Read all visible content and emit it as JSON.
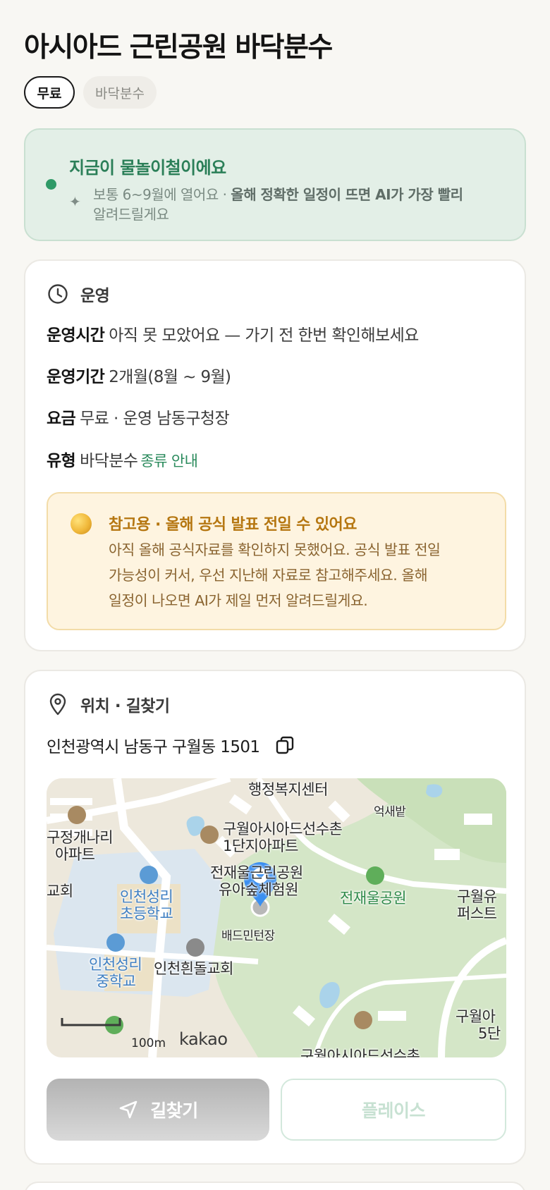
{
  "page": {
    "title": "아시아드 근린공원 바닥분수",
    "chips": {
      "price": "무료",
      "type": "바닥분수"
    }
  },
  "season": {
    "headline": "지금이 물놀이철이에요",
    "desc_plain": "보통 6~9월에 열어요 · ",
    "desc_bold": "올해 정확한 일정이 뜨면 AI가 가장 빨리",
    "desc_tail": "알려드릴게요",
    "icon": "sparkle-icon",
    "dot_color": "#2f9a67"
  },
  "operation": {
    "section_label": "운영",
    "icon": "clock-icon",
    "rows": {
      "hours": {
        "key": "운영시간",
        "value": "아직 못 모았어요 — 가기 전 한번 확인해보세요"
      },
      "period": {
        "key": "운영기간",
        "value": "2개월(8월 ~ 9월)"
      },
      "fee": {
        "key": "요금",
        "value": "무료 · 운영 남동구청장"
      },
      "type": {
        "key": "유형",
        "value": "바닥분수",
        "link": "종류 안내"
      }
    },
    "notice": {
      "title": "참고용 · 올해 공식 발표 전일 수 있어요",
      "line1": "아직 올해 공식자료를 확인하지 못했어요. 공식 발표 전일",
      "line2": "가능성이 커서, 우선 지난해 자료로 참고해주세요. 올해",
      "line3": "일정이 나오면 AI가 제일 먼저 알려드릴게요.",
      "icon": "moon-icon"
    }
  },
  "location": {
    "section_label": "위치 · 길찾기",
    "icon": "location-pin-icon",
    "address": "인천광역시 남동구 구월동 1501",
    "copy_icon": "copy-icon",
    "map": {
      "labels": {
        "center": "행정복지센터",
        "eoksae": "억새밭",
        "apt1a": "구월아시아드선수촌",
        "apt1b": "1단지아파트",
        "jeong1": "구정개나리",
        "jeong2": "아파트",
        "church_l": "교회",
        "school1a": "인천성리",
        "school1b": "초등학교",
        "park_a1": "전재울근린공원",
        "park_a2": "유아숲체험원",
        "park_b": "전재울공원",
        "guwol1": "구월유",
        "guwol2": "퍼스트",
        "badminton": "배드민턴장",
        "school2a": "인천성리",
        "school2b": "중학교",
        "church_b": "인천흰돌교회",
        "guwol5a": "구월아",
        "guwol5b": "5단",
        "bottom": "구월아시아드선수촌",
        "scale": "100m",
        "brand": "kakao"
      }
    },
    "buttons": {
      "navigate": "길찾기",
      "place": "플레이스"
    },
    "nav_icon": "navigation-arrow-icon"
  }
}
